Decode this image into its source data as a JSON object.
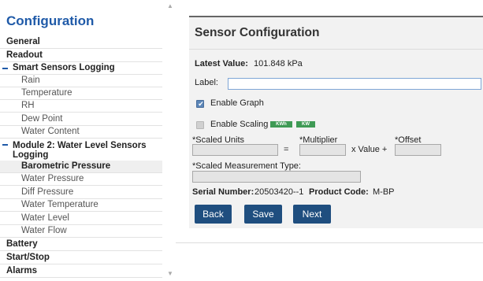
{
  "sidebar": {
    "title": "Configuration",
    "items": [
      {
        "label": "General",
        "level": "section"
      },
      {
        "label": "Readout",
        "level": "section"
      },
      {
        "label": "Smart Sensors Logging",
        "level": "group"
      },
      {
        "label": "Rain",
        "level": "sub"
      },
      {
        "label": "Temperature",
        "level": "sub"
      },
      {
        "label": "RH",
        "level": "sub"
      },
      {
        "label": "Dew Point",
        "level": "sub"
      },
      {
        "label": "Water Content",
        "level": "sub"
      },
      {
        "label": "Module 2: Water Level Sensors Logging",
        "level": "group"
      },
      {
        "label": "Barometric Pressure",
        "level": "sub",
        "selected": true
      },
      {
        "label": "Water Pressure",
        "level": "sub"
      },
      {
        "label": "Diff Pressure",
        "level": "sub"
      },
      {
        "label": "Water Temperature",
        "level": "sub"
      },
      {
        "label": "Water Level",
        "level": "sub"
      },
      {
        "label": "Water Flow",
        "level": "sub"
      },
      {
        "label": "Battery",
        "level": "section"
      },
      {
        "label": "Start/Stop",
        "level": "section"
      },
      {
        "label": "Alarms",
        "level": "section"
      }
    ]
  },
  "panel": {
    "title": "Sensor Configuration",
    "latest_value_label": "Latest Value:",
    "latest_value": "101.848 kPa",
    "label_field_label": "Label:",
    "label_value": "",
    "enable_graph_label": "Enable Graph",
    "enable_graph_checked": true,
    "enable_scaling_label": "Enable Scaling",
    "enable_scaling_checked": false,
    "unit_badges": [
      "KWh",
      "KW"
    ],
    "scaled_units_label": "*Scaled Units",
    "equals_sign": "=",
    "multiplier_label": "*Multiplier",
    "x_value_plus": "x Value +",
    "offset_label": "*Offset",
    "scaled_measurement_type_label": "*Scaled Measurement Type:",
    "serial_number_label": "Serial Number:",
    "serial_number": "20503420--1",
    "product_code_label": "Product Code:",
    "product_code": "M-BP",
    "buttons": {
      "back": "Back",
      "save": "Save",
      "next": "Next"
    }
  },
  "colors": {
    "accent": "#1f5aa8",
    "button": "#1f4e7f",
    "badge": "#3f9a55"
  }
}
